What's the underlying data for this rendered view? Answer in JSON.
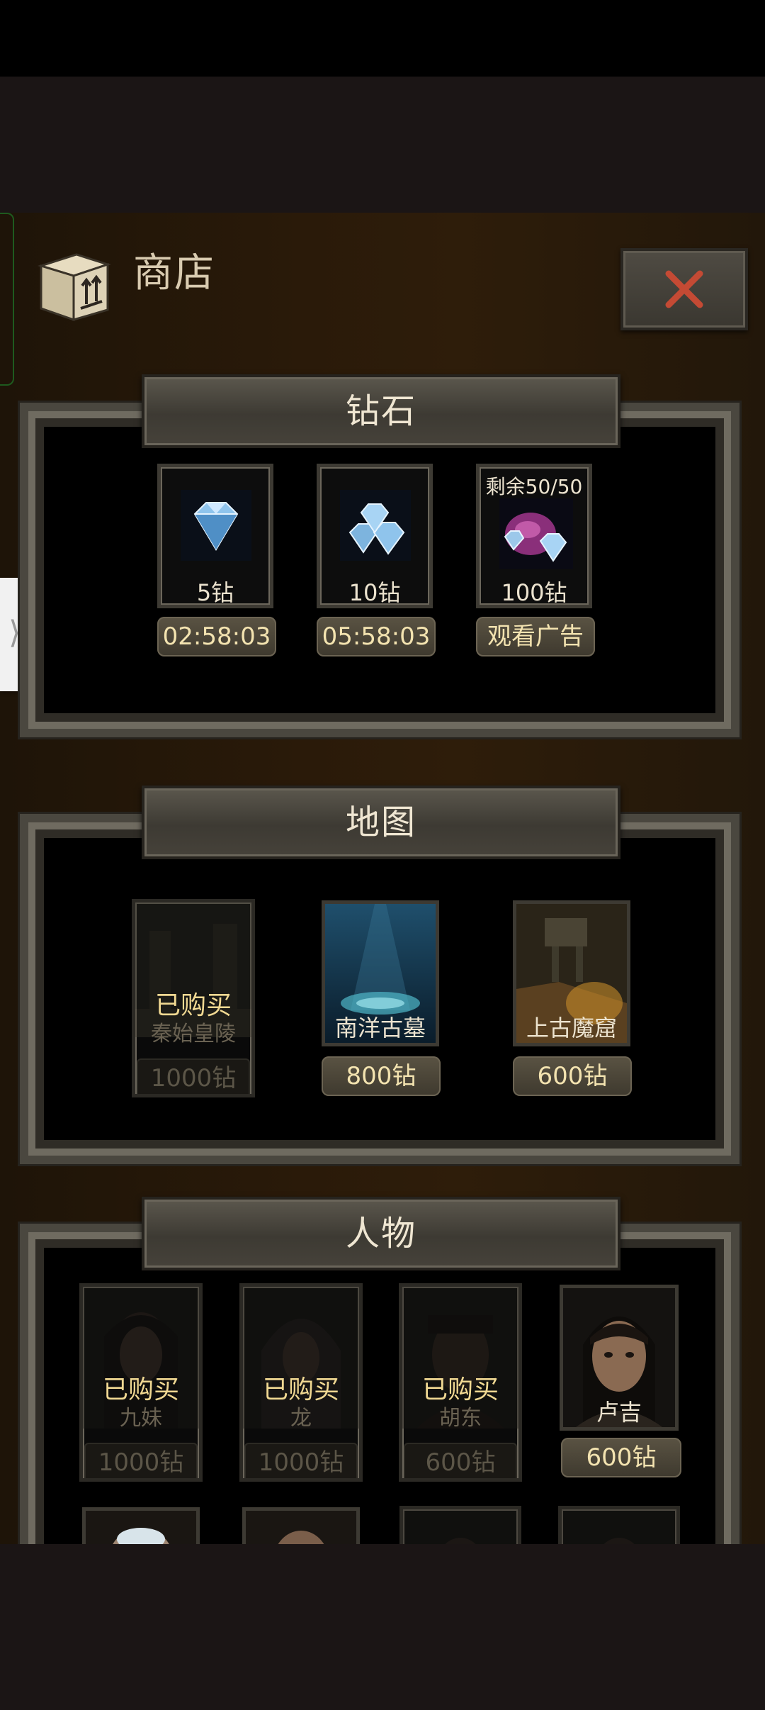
{
  "header": {
    "title": "商店"
  },
  "sections": [
    {
      "title": "钻石",
      "items": [
        {
          "label": "5钻",
          "button": "02:58:03",
          "icon": "diamond-icon"
        },
        {
          "label": "10钻",
          "button": "05:58:03",
          "icon": "diamond-pile-icon"
        },
        {
          "label": "100钻",
          "top_label": "剩余50/50",
          "button": "观看广告",
          "icon": "diamond-bag-icon"
        }
      ]
    },
    {
      "title": "地图",
      "items": [
        {
          "name": "秦始皇陵",
          "price": "1000钻",
          "status": "已购买"
        },
        {
          "name": "南洋古墓",
          "price": "800钻"
        },
        {
          "name": "上古魔窟",
          "price": "600钻"
        }
      ]
    },
    {
      "title": "人物",
      "items": [
        {
          "name": "九妹",
          "price": "1000钻",
          "status": "已购买"
        },
        {
          "name": "龙",
          "price": "1000钻",
          "status": "已购买"
        },
        {
          "name": "胡东",
          "price": "600钻",
          "status": "已购买"
        },
        {
          "name": "卢吉",
          "price": "600钻"
        }
      ]
    }
  ],
  "colors": {
    "gold_text": "#f0d892",
    "panel_bg": "#000000",
    "frame": "#4a473f"
  }
}
